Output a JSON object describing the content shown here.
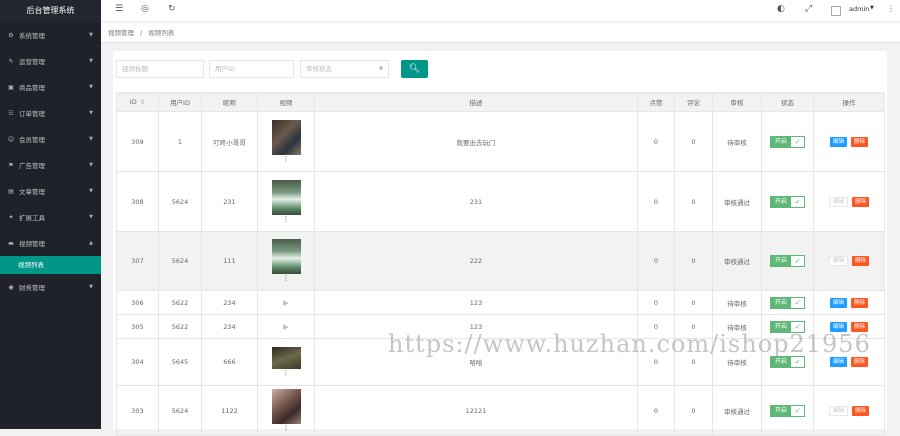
{
  "app": {
    "title": "后台管理系统"
  },
  "sidebar": {
    "items": [
      {
        "label": "系统管理",
        "icon": "gear-icon"
      },
      {
        "label": "运营管理",
        "icon": "edit-icon"
      },
      {
        "label": "商品管理",
        "icon": "image-icon"
      },
      {
        "label": "订单管理",
        "icon": "list-icon"
      },
      {
        "label": "会员管理",
        "icon": "users-icon"
      },
      {
        "label": "广告管理",
        "icon": "flag-icon"
      },
      {
        "label": "文章管理",
        "icon": "file-icon"
      },
      {
        "label": "扩展工具",
        "icon": "wrench-icon"
      },
      {
        "label": "视频管理",
        "icon": "video-icon"
      },
      {
        "label": "财务管理",
        "icon": "money-icon"
      }
    ],
    "active_sub": "视频列表"
  },
  "header": {
    "user": "admin"
  },
  "breadcrumb": {
    "parent": "视频管理",
    "sep": "/",
    "current": "视频列表"
  },
  "search": {
    "title_placeholder": "视频标题",
    "uid_placeholder": "用户ID",
    "status_placeholder": "审核状态"
  },
  "table": {
    "columns": [
      "ID",
      "用户ID",
      "昵称",
      "视频",
      "描述",
      "点赞",
      "评论",
      "审核",
      "状态",
      "操作"
    ],
    "switch_label": "开启",
    "edit_label": "编辑",
    "delete_label": "删除",
    "rows": [
      {
        "id": "309",
        "uid": "1",
        "nick": "叮咚小哥哥",
        "thumb": "photo",
        "desc": "就要出去玩门",
        "likes": "0",
        "comments": "0",
        "audit": "待审核",
        "edit_disabled": false
      },
      {
        "id": "308",
        "uid": "5624",
        "nick": "231",
        "thumb": "green",
        "desc": "231",
        "likes": "0",
        "comments": "0",
        "audit": "审核通过",
        "edit_disabled": true
      },
      {
        "id": "307",
        "uid": "5624",
        "nick": "111",
        "thumb": "green",
        "desc": "222",
        "likes": "0",
        "comments": "0",
        "audit": "审核通过",
        "edit_disabled": true
      },
      {
        "id": "306",
        "uid": "5622",
        "nick": "234",
        "thumb": "play",
        "desc": "123",
        "likes": "0",
        "comments": "0",
        "audit": "待审核",
        "edit_disabled": false
      },
      {
        "id": "305",
        "uid": "5622",
        "nick": "234",
        "thumb": "play",
        "desc": "123",
        "likes": "0",
        "comments": "0",
        "audit": "待审核",
        "edit_disabled": false
      },
      {
        "id": "304",
        "uid": "5645",
        "nick": "666",
        "thumb": "photo2",
        "desc": "哈哈",
        "likes": "0",
        "comments": "0",
        "audit": "待审核",
        "edit_disabled": false
      },
      {
        "id": "303",
        "uid": "5624",
        "nick": "1122",
        "thumb": "photo3",
        "desc": "12121",
        "likes": "0",
        "comments": "0",
        "audit": "审核通过",
        "edit_disabled": true
      }
    ]
  },
  "watermark": "https://www.huzhan.com/ishop21956"
}
